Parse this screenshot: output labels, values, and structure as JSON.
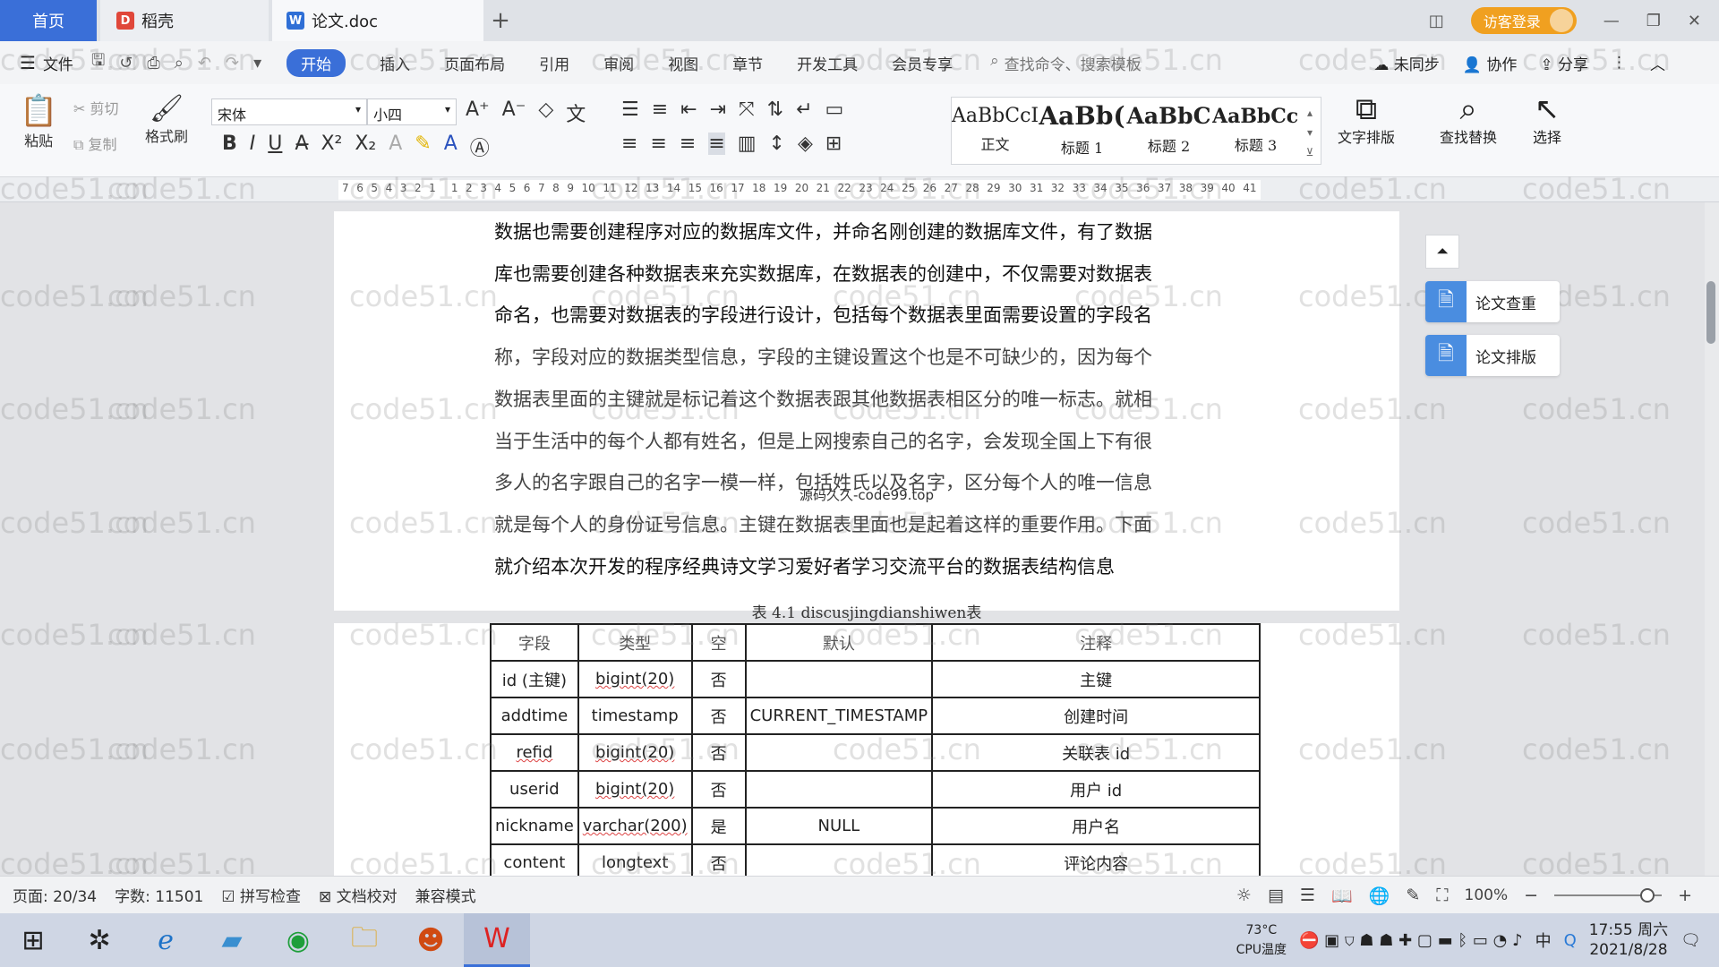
{
  "tabs": {
    "home": "首页",
    "daoke": "稻壳",
    "doc": "论文.doc",
    "add": "+"
  },
  "titlebar": {
    "visitor_login": "访客登录"
  },
  "menu": {
    "file": "文件",
    "items": [
      "开始",
      "插入",
      "页面布局",
      "引用",
      "审阅",
      "视图",
      "章节",
      "开发工具",
      "会员专享"
    ],
    "search_placeholder": "查找命令、搜索模板",
    "unsynced": "未同步",
    "collab": "协作",
    "share": "分享"
  },
  "ribbon": {
    "paste": "粘贴",
    "cut": "剪切",
    "copy": "复制",
    "format_painter": "格式刷",
    "font_name": "宋体",
    "font_size": "小四",
    "styles": [
      {
        "sample": "AaBbCcI",
        "name": "正文"
      },
      {
        "sample": "AaBb(",
        "name": "标题 1"
      },
      {
        "sample": "AaBbC",
        "name": "标题 2"
      },
      {
        "sample": "AaBbCcI",
        "name": "标题 3"
      }
    ],
    "text_layout": "文字排版",
    "find_replace": "查找替换",
    "select": "选择"
  },
  "ruler": {
    "ticks": [
      "7",
      "6",
      "5",
      "4",
      "3",
      "2",
      "1",
      "",
      "1",
      "2",
      "3",
      "4",
      "5",
      "6",
      "7",
      "8",
      "9",
      "10",
      "11",
      "12",
      "13",
      "14",
      "15",
      "16",
      "17",
      "18",
      "19",
      "20",
      "21",
      "22",
      "23",
      "24",
      "25",
      "26",
      "27",
      "28",
      "29",
      "30",
      "31",
      "32",
      "33",
      "34",
      "35",
      "36",
      "37",
      "38",
      "39",
      "40",
      "41"
    ]
  },
  "document": {
    "paragraph_lines": [
      "数据也需要创建程序对应的数据库文件，并命名刚创建的数据库文件，有了数据",
      "库也需要创建各种数据表来充实数据库，在数据表的创建中，不仅需要对数据表",
      "命名，也需要对数据表的字段进行设计，包括每个数据表里面需要设置的字段名",
      "称，字段对应的数据类型信息，字段的主键设置这个也是不可缺少的，因为每个",
      "数据表里面的主键就是标记着这个数据表跟其他数据表相区分的唯一标志。就相",
      "当于生活中的每个人都有姓名，但是上网搜索自己的名字，会发现全国上下有很",
      "多人的名字跟自己的名字一模一样，包括姓氏以及名字，区分每个人的唯一信息",
      "就是每个人的身份证号信息。主键在数据表里面也是起着这样的重要作用。下面",
      "就介绍本次开发的程序经典诗文学习爱好者学习交流平台的数据表结构信息"
    ],
    "overlay_text": "源码久久-code99.top",
    "table_caption": "表 4.1 discusjingdianshiwen表",
    "table_headers": [
      "字段",
      "类型",
      "空",
      "默认",
      "注释"
    ],
    "table_rows": [
      [
        "id (主键)",
        "bigint(20)",
        "否",
        "",
        "主键"
      ],
      [
        "addtime",
        "timestamp",
        "否",
        "CURRENT_TIMESTAMP",
        "创建时间"
      ],
      [
        "refid",
        "bigint(20)",
        "否",
        "",
        "关联表 id"
      ],
      [
        "userid",
        "bigint(20)",
        "否",
        "",
        "用户 id"
      ],
      [
        "nickname",
        "varchar(200)",
        "是",
        "NULL",
        "用户名"
      ],
      [
        "content",
        "longtext",
        "否",
        "",
        "评论内容"
      ]
    ]
  },
  "side_panel": {
    "check": "论文查重",
    "layout": "论文排版"
  },
  "watermark_text": "code51.cn",
  "status": {
    "page": "页面: 20/34",
    "words": "字数: 11501",
    "spell": "拼写检查",
    "proof": "文档校对",
    "compat": "兼容模式",
    "zoom": "100%"
  },
  "taskbar": {
    "temp": "73°C",
    "cpu": "CPU温度",
    "time": "17:55 周六",
    "date": "2021/8/28",
    "ime": "中"
  },
  "colors": {
    "accent": "#3a6fd8",
    "visitor": "#f0a020"
  }
}
